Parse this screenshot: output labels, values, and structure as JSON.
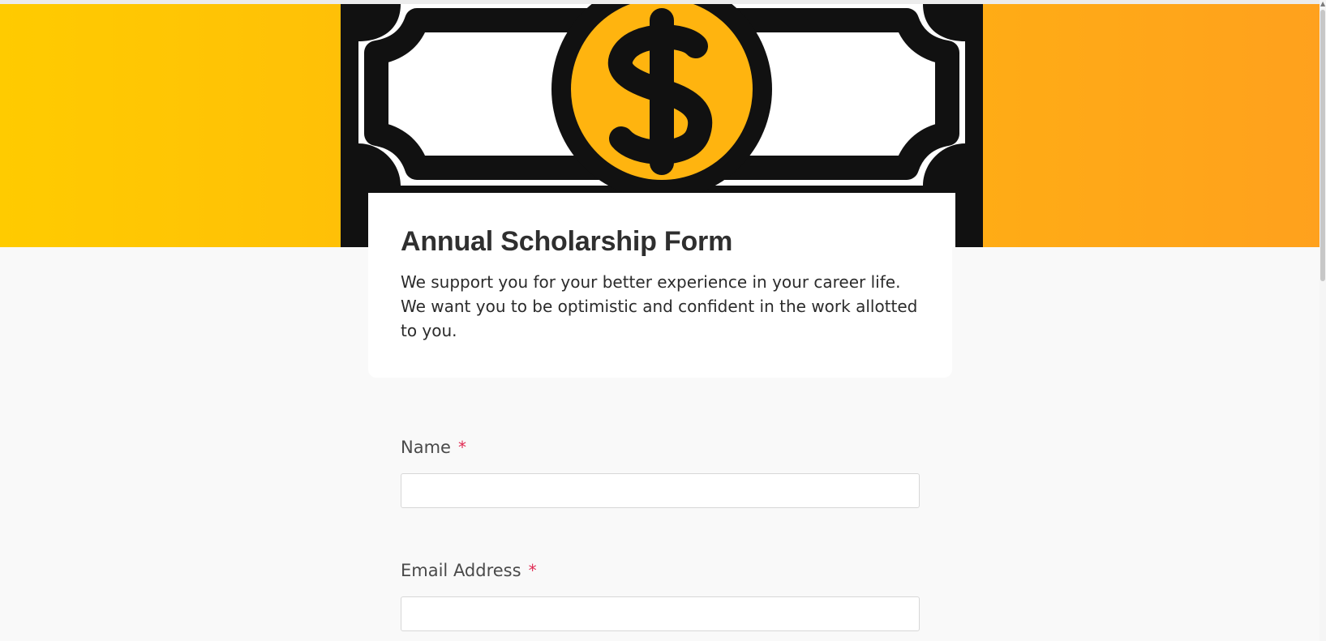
{
  "banner": {
    "icon": "dollar-bill-icon",
    "gradient_colors": [
      "#ffcb00",
      "#ffb40f",
      "#ffa11d"
    ],
    "coin_color": "#ffb40f"
  },
  "form": {
    "title": "Annual Scholarship Form",
    "description": "We support you for your better experience in your career life. We want you to be optimistic and confident in the work allotted to you."
  },
  "fields": [
    {
      "label": "Name",
      "required_mark": "*",
      "value": ""
    },
    {
      "label": "Email Address",
      "required_mark": "*",
      "value": ""
    }
  ],
  "colors": {
    "page_background": "#f9f9f9",
    "card_background": "#ffffff",
    "required": "#e02b53",
    "title_text": "#2f2f2f"
  }
}
